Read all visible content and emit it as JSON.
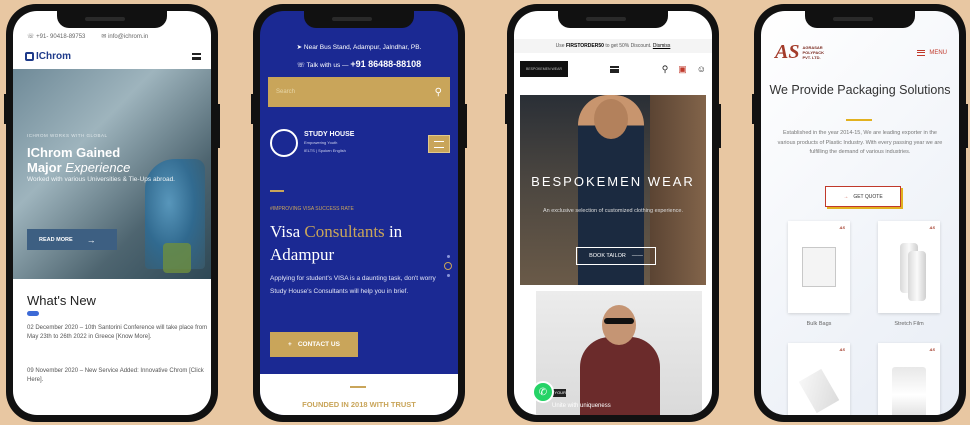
{
  "phone1": {
    "phone": "+91- 90418-89753",
    "email": "info@ichrom.in",
    "logo": "IChrom",
    "kicker": "ICHROM WORKS WITH GLOBAL",
    "title_1": "IChrom Gained",
    "title_2": "Major",
    "title_3": "Experience",
    "subtitle": "Worked with various Universities & Tie-Ups abroad.",
    "read_more": "READ MORE",
    "news_heading": "What's New",
    "news": [
      "02 December 2020 – 10th Santorini Conference will take place from May 23th to 26th 2022 in Greece [Know More].",
      "09 November 2020 – New Service Added: Innovative Chrom [Click Here]."
    ]
  },
  "phone2": {
    "address": "Near Bus Stand, Adampur, Jalndhar, PB.",
    "talk_label": "Talk with us",
    "phone": "+91 86488-88108",
    "search_placeholder": "Search",
    "logo_name": "STUDY HOUSE",
    "logo_tag": "Empowering Youth",
    "logo_sub": "IELTS | Spoken English",
    "kicker": "#IMPROVING VISA SUCCESS RATE",
    "title_a": "Visa",
    "title_b": "Consultants",
    "title_c": "in",
    "title_d": "Adampur",
    "description": "Applying for student's VISA is a daunting task, don't worry Study House's Consultants will help you in brief.",
    "cta": "CONTACT US",
    "founded": "FOUNDED IN 2018 WITH TRUST"
  },
  "phone3": {
    "promo_prefix": "Use",
    "promo_code": "FIRSTORDER50",
    "promo_suffix": "to get 50% Discount.",
    "promo_link": "Dismiss",
    "logo": "BESPOKEMEN WEAR",
    "title": "BESPOKEMEN WEAR",
    "subtitle": "An exclusive selection of customized clothing experience.",
    "button": "BOOK TAILOR",
    "tag": "CHOOSE YOUR",
    "unite": "Unite with uniqueness"
  },
  "phone4": {
    "logo_mark": "AS",
    "logo_name_1": "AGRASAR",
    "logo_name_2": "POLYPACK",
    "logo_name_3": "PVT. LTD.",
    "menu": "MENU",
    "title": "We Provide Packaging Solutions",
    "description": "Established in the year 2014-15, We are leading exporter in the various products of Plastic Industry. With every passing year we are fulfilling the demand of various industries.",
    "button": "GET QUOTE",
    "products": [
      "Bulk Bags",
      "Stretch Film",
      "",
      ""
    ]
  }
}
